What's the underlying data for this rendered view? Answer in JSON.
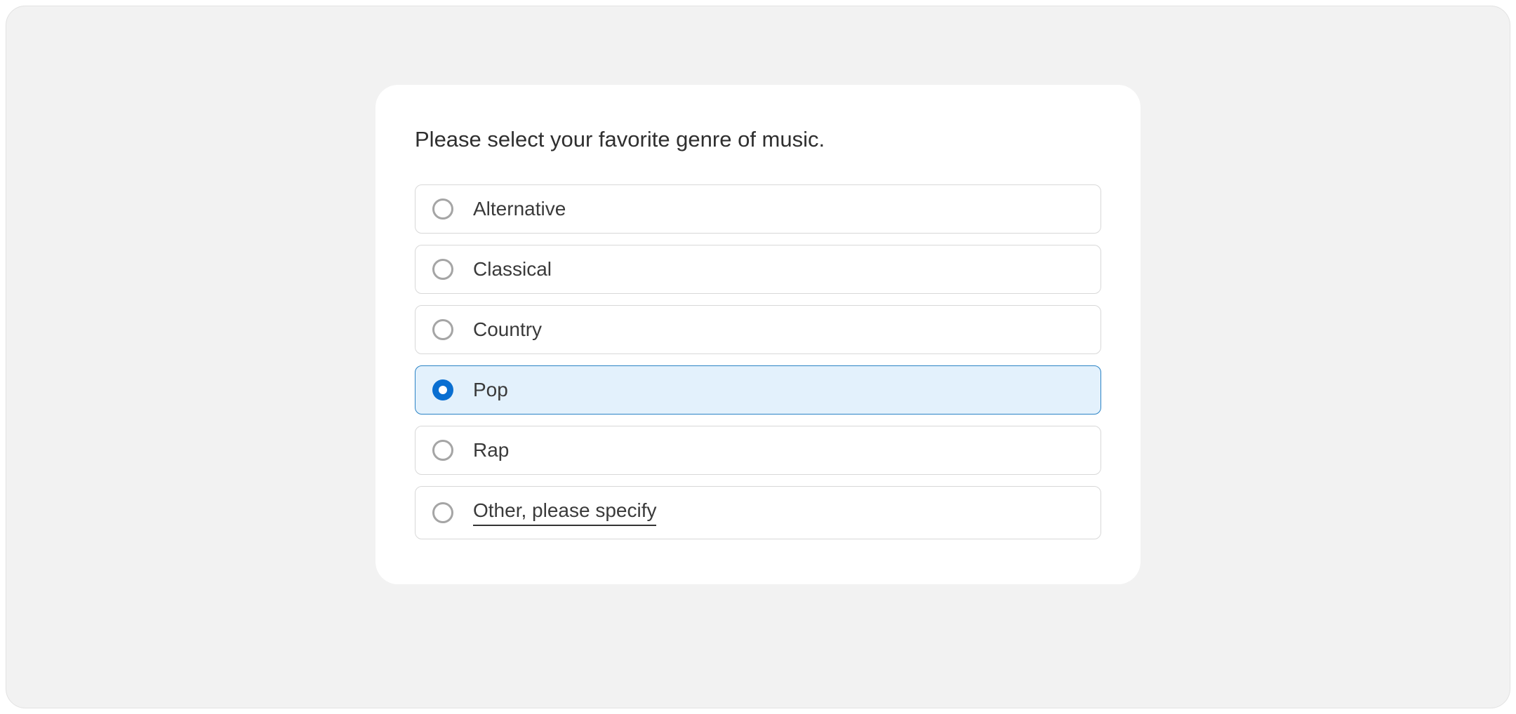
{
  "question": {
    "title": "Please select your favorite genre of music.",
    "selected_index": 3,
    "options": [
      {
        "label": "Alternative",
        "underlined": false
      },
      {
        "label": "Classical",
        "underlined": false
      },
      {
        "label": "Country",
        "underlined": false
      },
      {
        "label": "Pop",
        "underlined": false
      },
      {
        "label": "Rap",
        "underlined": false
      },
      {
        "label": "Other, please specify",
        "underlined": true
      }
    ]
  }
}
